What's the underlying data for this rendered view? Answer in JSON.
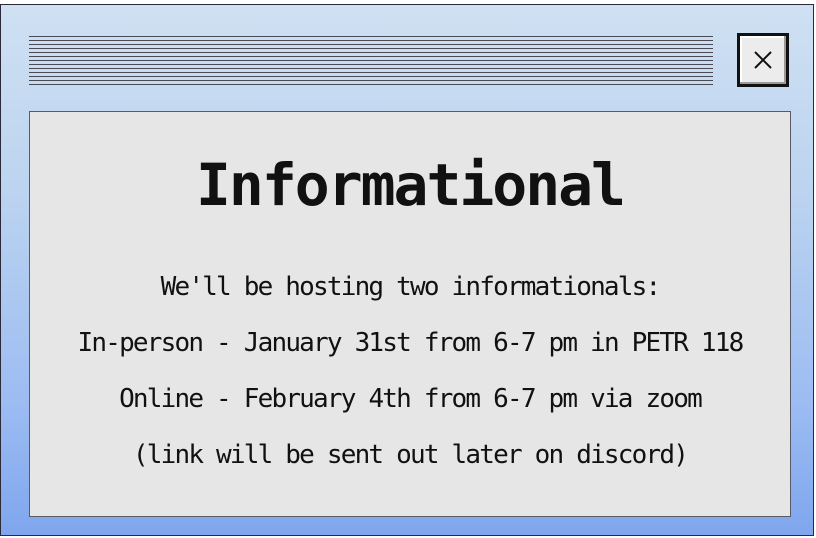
{
  "window": {
    "close_icon": "close-icon"
  },
  "panel": {
    "heading": "Informational",
    "lines": [
      "We'll be hosting two informationals:",
      "In-person - January 31st from 6-7 pm in PETR 118",
      "Online - February 4th from 6-7 pm via zoom",
      "(link will be sent out later on discord)"
    ]
  },
  "colors": {
    "background_top": "#cfe0f2",
    "background_bottom": "#7fa6ee",
    "panel_background": "#e6e6e6",
    "text": "#111111"
  }
}
